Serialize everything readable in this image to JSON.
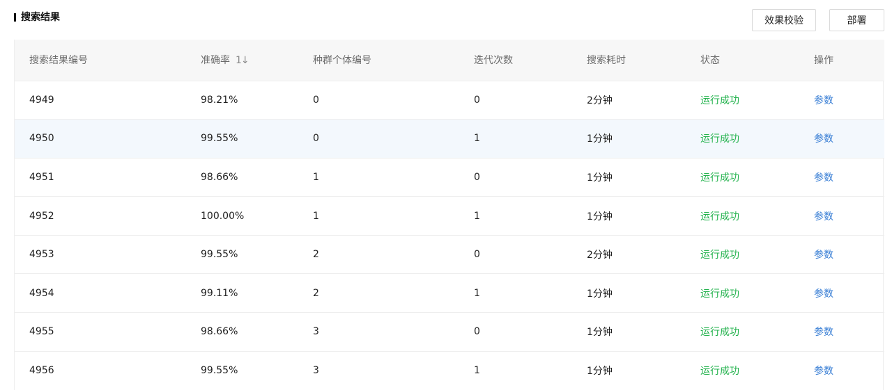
{
  "section": {
    "title": "搜索结果"
  },
  "toolbar": {
    "verify_label": "效果校验",
    "deploy_label": "部署"
  },
  "table": {
    "columns": [
      "搜索结果编号",
      "准确率",
      "种群个体编号",
      "迭代次数",
      "搜索耗时",
      "状态",
      "操作"
    ],
    "sort_icon": "1↓",
    "rows": [
      {
        "id": "4949",
        "accuracy": "98.21%",
        "individual": "0",
        "iterations": "0",
        "duration": "2分钟",
        "status": "运行成功",
        "action": "参数"
      },
      {
        "id": "4950",
        "accuracy": "99.55%",
        "individual": "0",
        "iterations": "1",
        "duration": "1分钟",
        "status": "运行成功",
        "action": "参数"
      },
      {
        "id": "4951",
        "accuracy": "98.66%",
        "individual": "1",
        "iterations": "0",
        "duration": "1分钟",
        "status": "运行成功",
        "action": "参数"
      },
      {
        "id": "4952",
        "accuracy": "100.00%",
        "individual": "1",
        "iterations": "1",
        "duration": "1分钟",
        "status": "运行成功",
        "action": "参数"
      },
      {
        "id": "4953",
        "accuracy": "99.55%",
        "individual": "2",
        "iterations": "0",
        "duration": "2分钟",
        "status": "运行成功",
        "action": "参数"
      },
      {
        "id": "4954",
        "accuracy": "99.11%",
        "individual": "2",
        "iterations": "1",
        "duration": "1分钟",
        "status": "运行成功",
        "action": "参数"
      },
      {
        "id": "4955",
        "accuracy": "98.66%",
        "individual": "3",
        "iterations": "0",
        "duration": "1分钟",
        "status": "运行成功",
        "action": "参数"
      },
      {
        "id": "4956",
        "accuracy": "99.55%",
        "individual": "3",
        "iterations": "1",
        "duration": "1分钟",
        "status": "运行成功",
        "action": "参数"
      }
    ]
  },
  "colors": {
    "status_success": "#22b24c",
    "link": "#3a7fd5",
    "header_bg": "#f7f7f7",
    "row_highlight": "#f3f8fd"
  },
  "icons": {
    "sort": "sort-icon"
  }
}
